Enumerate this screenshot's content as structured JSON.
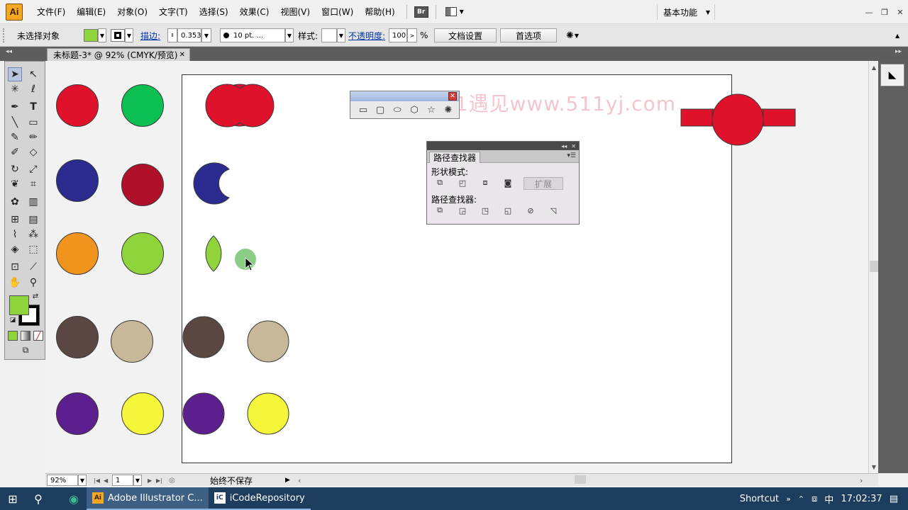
{
  "app": {
    "logo": "Ai"
  },
  "menu": [
    "文件(F)",
    "编辑(E)",
    "对象(O)",
    "文字(T)",
    "选择(S)",
    "效果(C)",
    "视图(V)",
    "窗口(W)",
    "帮助(H)"
  ],
  "menu_buttons": {
    "bridge": "Br"
  },
  "workspace": {
    "label": "基本功能"
  },
  "window_controls": {
    "minimize": "—",
    "restore": "❐",
    "close": "✕"
  },
  "controlbar": {
    "selection": "未选择对象",
    "fill_color": "#8ed43c",
    "stroke_label": "描边:",
    "stroke_value": "0.353",
    "brush_label": "10 pt. ...",
    "style_label": "样式:",
    "opacity_label": "不透明度:",
    "opacity_value": "100",
    "percent": "%",
    "doc_settings": "文档设置",
    "preferences": "首选项"
  },
  "tab": {
    "title": "未标题-3* @ 92% (CMYK/预览)",
    "close": "✕"
  },
  "tools": {
    "fill": "#8ed43c",
    "stroke": "#000000"
  },
  "canvas": {
    "colors": {
      "red": "#e0112a",
      "green": "#0bbf52",
      "navy": "#2a2a8f",
      "crimson": "#b1102a",
      "orange": "#f0941e",
      "lime": "#90d43c",
      "brown": "#5a4742",
      "tan": "#c8b89a",
      "purple": "#5d1e8f",
      "yellow": "#f5f53a",
      "ghost": "#7dc87a"
    }
  },
  "shapes_panel": {
    "close": "✕"
  },
  "pathfinder": {
    "tab": "路径查找器",
    "shape_modes": "形状模式:",
    "pathfinders": "路径查找器:",
    "expand": "扩展"
  },
  "watermark": "511遇见www.511yj.com",
  "statusbar": {
    "zoom": "92%",
    "page": "1",
    "status": "始终不保存"
  },
  "taskbar": {
    "apps": [
      {
        "label": "Adobe Illustrator C...",
        "badge": "Ai"
      },
      {
        "label": "iCodeRepository",
        "badge": "iC"
      }
    ],
    "shortcut": "Shortcut",
    "ime": "中",
    "time": "17:02:37"
  }
}
